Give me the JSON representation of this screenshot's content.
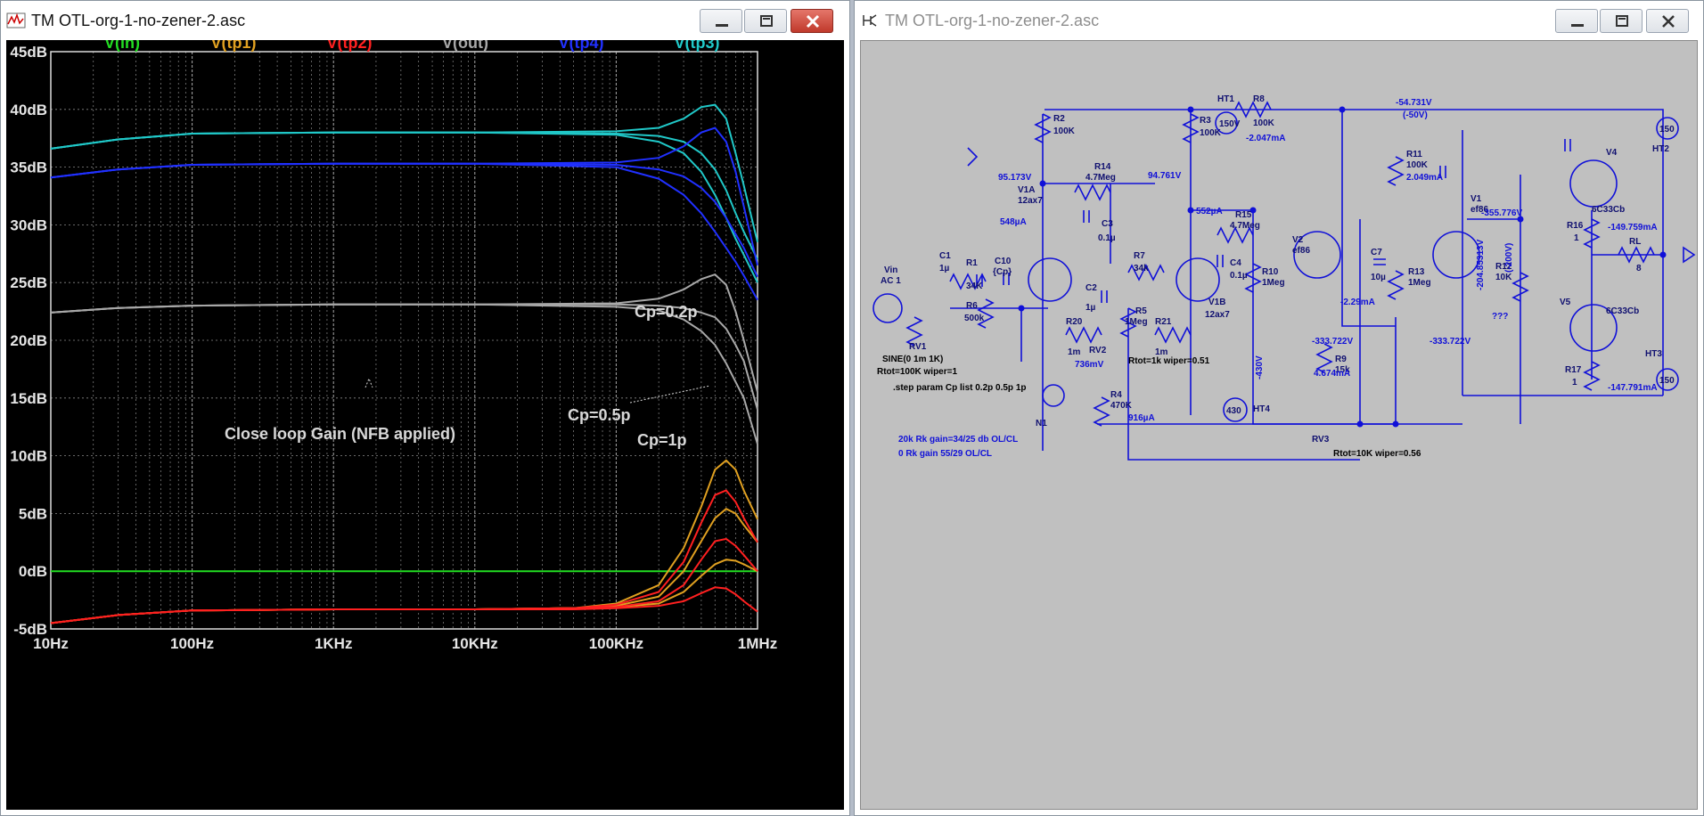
{
  "left_window": {
    "title": "TM OTL-org-1-no-zener-2.asc"
  },
  "right_window": {
    "title": "TM OTL-org-1-no-zener-2.asc"
  },
  "plot": {
    "traces": [
      {
        "name": "V(in)",
        "color": "#22dd22"
      },
      {
        "name": "V(tp1)",
        "color": "#e0a020"
      },
      {
        "name": "V(tp2)",
        "color": "#ff2020"
      },
      {
        "name": "V(out)",
        "color": "#a8a8a8"
      },
      {
        "name": "V(tp4)",
        "color": "#2030ff"
      },
      {
        "name": "V(tp3)",
        "color": "#20c8c8"
      }
    ],
    "annotations": {
      "cp02": "Cp=0.2p",
      "cp05": "Cp=0.5p",
      "cp1": "Cp=1p",
      "close_loop": "Close loop Gain (NFB applied)"
    }
  },
  "chart_data": {
    "type": "line",
    "xscale": "log",
    "xlim": [
      10,
      1000000
    ],
    "ylim": [
      -5,
      45
    ],
    "x_tick_labels": [
      "10Hz",
      "100Hz",
      "1KHz",
      "10KHz",
      "100KHz",
      "1MHz"
    ],
    "y_tick_labels": [
      "45dB",
      "40dB",
      "35dB",
      "30dB",
      "25dB",
      "20dB",
      "15dB",
      "10dB",
      "5dB",
      "0dB",
      "-5dB"
    ],
    "grid": true,
    "legend": "top",
    "series": [
      {
        "name": "V(in)",
        "color": "#22dd22",
        "curves": [
          {
            "x": [
              10,
              1000000
            ],
            "y": [
              0,
              0
            ]
          }
        ]
      },
      {
        "name": "V(tp3)",
        "color": "#20c8c8",
        "curves": [
          {
            "x": [
              10,
              30,
              100,
              1000,
              10000,
              100000,
              200000,
              300000,
              400000,
              500000,
              600000,
              700000,
              800000,
              1000000
            ],
            "y": [
              36.6,
              37.4,
              37.9,
              38,
              38,
              38.1,
              38.4,
              39.2,
              40.2,
              40.4,
              39.2,
              36.2,
              33.4,
              28.5
            ]
          },
          {
            "x": [
              10,
              30,
              100,
              1000,
              10000,
              100000,
              200000,
              300000,
              400000,
              500000,
              600000,
              700000,
              800000,
              1000000
            ],
            "y": [
              36.6,
              37.4,
              37.9,
              38,
              38,
              37.9,
              37.7,
              37.2,
              36.2,
              34.8,
              33,
              31,
              29.4,
              27
            ]
          },
          {
            "x": [
              10,
              30,
              100,
              1000,
              10000,
              100000,
              200000,
              300000,
              400000,
              500000,
              600000,
              700000,
              800000,
              1000000
            ],
            "y": [
              36.6,
              37.4,
              37.9,
              38,
              38,
              37.8,
              37.2,
              36.2,
              34.6,
              32.6,
              30.6,
              28.8,
              27.4,
              25
            ]
          }
        ]
      },
      {
        "name": "V(tp4)",
        "color": "#2030ff",
        "curves": [
          {
            "x": [
              10,
              30,
              100,
              1000,
              10000,
              100000,
              200000,
              300000,
              400000,
              500000,
              600000,
              700000,
              800000,
              1000000
            ],
            "y": [
              34.1,
              34.8,
              35.2,
              35.3,
              35.3,
              35.4,
              35.8,
              36.8,
              38,
              38.4,
              37.2,
              34.6,
              31.6,
              26.5
            ]
          },
          {
            "x": [
              10,
              30,
              100,
              1000,
              10000,
              100000,
              200000,
              300000,
              400000,
              500000,
              600000,
              700000,
              800000,
              1000000
            ],
            "y": [
              34.1,
              34.8,
              35.2,
              35.3,
              35.3,
              35.2,
              34.8,
              34.2,
              33.2,
              32,
              30.6,
              29.2,
              28,
              25.5
            ]
          },
          {
            "x": [
              10,
              30,
              100,
              1000,
              10000,
              100000,
              200000,
              300000,
              400000,
              500000,
              600000,
              700000,
              800000,
              1000000
            ],
            "y": [
              34.1,
              34.8,
              35.2,
              35.3,
              35.3,
              35,
              34,
              32.6,
              31,
              29.4,
              28,
              26.8,
              25.6,
              23.5
            ]
          }
        ]
      },
      {
        "name": "V(out)",
        "color": "#a8a8a8",
        "curves": [
          {
            "x": [
              10,
              30,
              100,
              1000,
              10000,
              100000,
              200000,
              300000,
              400000,
              500000,
              600000,
              700000,
              800000,
              1000000
            ],
            "y": [
              22.4,
              22.8,
              23,
              23.1,
              23.1,
              23.2,
              23.6,
              24.4,
              25.3,
              25.7,
              24.8,
              22.5,
              20,
              15.5
            ]
          },
          {
            "x": [
              10,
              30,
              100,
              1000,
              10000,
              100000,
              200000,
              300000,
              400000,
              500000,
              600000,
              700000,
              800000,
              1000000
            ],
            "y": [
              22.4,
              22.8,
              23,
              23.1,
              23.1,
              23.1,
              23,
              22.8,
              22.4,
              22,
              21,
              19.6,
              18.2,
              14
            ]
          },
          {
            "x": [
              10,
              30,
              100,
              1000,
              10000,
              100000,
              200000,
              300000,
              400000,
              500000,
              600000,
              700000,
              800000,
              1000000
            ],
            "y": [
              22.4,
              22.8,
              23,
              23.1,
              23.1,
              22.9,
              22.6,
              21.8,
              20.8,
              19.6,
              18,
              16.4,
              15,
              11
            ]
          }
        ]
      },
      {
        "name": "V(tp1)",
        "color": "#e0a020",
        "curves": [
          {
            "x": [
              10,
              30,
              100,
              1000,
              10000,
              50000,
              100000,
              200000,
              300000,
              400000,
              500000,
              600000,
              700000,
              800000,
              1000000
            ],
            "y": [
              -4.5,
              -3.8,
              -3.4,
              -3.3,
              -3.3,
              -3.2,
              -2.8,
              -1.2,
              2,
              5.6,
              8.8,
              9.6,
              8.8,
              7,
              4.5
            ]
          },
          {
            "x": [
              10,
              30,
              100,
              1000,
              10000,
              50000,
              100000,
              200000,
              300000,
              400000,
              500000,
              600000,
              700000,
              800000,
              1000000
            ],
            "y": [
              -4.5,
              -3.8,
              -3.4,
              -3.3,
              -3.3,
              -3.2,
              -3,
              -2.2,
              0,
              2.6,
              4.6,
              5.4,
              5,
              4,
              2.5
            ]
          },
          {
            "x": [
              10,
              30,
              100,
              1000,
              10000,
              50000,
              100000,
              200000,
              300000,
              400000,
              500000,
              600000,
              700000,
              800000,
              1000000
            ],
            "y": [
              -4.5,
              -3.8,
              -3.4,
              -3.3,
              -3.3,
              -3.2,
              -3.1,
              -2.8,
              -1.8,
              -0.4,
              0.6,
              1,
              0.9,
              0.6,
              0
            ]
          }
        ]
      },
      {
        "name": "V(tp2)",
        "color": "#ff2020",
        "curves": [
          {
            "x": [
              10,
              30,
              100,
              1000,
              10000,
              50000,
              100000,
              200000,
              300000,
              400000,
              500000,
              600000,
              700000,
              800000,
              1000000
            ],
            "y": [
              -4.5,
              -3.8,
              -3.4,
              -3.3,
              -3.3,
              -3.2,
              -2.9,
              -1.8,
              0.8,
              4.2,
              6.6,
              7,
              6,
              4.6,
              2.5
            ]
          },
          {
            "x": [
              10,
              30,
              100,
              1000,
              10000,
              50000,
              100000,
              200000,
              300000,
              400000,
              500000,
              600000,
              700000,
              800000,
              1000000
            ],
            "y": [
              -4.5,
              -3.8,
              -3.4,
              -3.3,
              -3.3,
              -3.2,
              -3.1,
              -2.6,
              -1.2,
              1,
              2.6,
              2.8,
              2.2,
              1.4,
              0
            ]
          },
          {
            "x": [
              10,
              30,
              100,
              1000,
              10000,
              50000,
              100000,
              200000,
              300000,
              400000,
              500000,
              600000,
              700000,
              800000,
              1000000
            ],
            "y": [
              -4.5,
              -3.8,
              -3.4,
              -3.3,
              -3.3,
              -3.3,
              -3.2,
              -3,
              -2.6,
              -1.9,
              -1.4,
              -1.5,
              -2,
              -2.6,
              -3.5
            ]
          }
        ]
      }
    ]
  },
  "schematic": {
    "components": [
      "HT1",
      "R8",
      "100K",
      "R2",
      "100K",
      "R3",
      "100K",
      "R14",
      "4.7Meg",
      "C3",
      "0.1µ",
      "V1A",
      "12ax7",
      "R15",
      "4.7Meg",
      "C4",
      "0.1µ",
      "V2",
      "ef86",
      "C7",
      "10µ",
      "R13",
      "1Meg",
      "V1",
      "ef86",
      "R11",
      "100K",
      "R12",
      "10K",
      "V4",
      "6C33Cb",
      "HT2",
      "150",
      "R16",
      "1",
      "RL",
      "8",
      "V5",
      "6C33Cb",
      "R17",
      "1",
      "HT3",
      "150",
      "C1",
      "1µ",
      "R1",
      "34K",
      "R6",
      "500k",
      "C10",
      "{Cp}",
      "C2",
      "1µ",
      "R7",
      "34k",
      "R5",
      "1Meg",
      "V1B",
      "12ax7",
      "R10",
      "1Meg",
      "R20",
      "1m",
      "RV2",
      "R21",
      "1m",
      "R4",
      "470K",
      "HT4",
      "430",
      "R9",
      "15k",
      "RV3",
      "RV1",
      "Vin",
      "AC 1",
      "N1",
      "150V"
    ],
    "voltages": {
      "v_54731": "-54.731V",
      "v_50": "(-50V)",
      "i_2047": "-2.047mA",
      "v_95173": "95.173V",
      "v_94761": "94.761V",
      "i_548": "548µA",
      "i_552": "552µA",
      "i_2049": "2.049mA",
      "v_355776": "-355.776V",
      "v_204853": "-204.85313V",
      "v_200": "(-200V)",
      "i_149759": "-149.759mA",
      "i_229": "-2.29mA",
      "v_333722a": "-333.722V",
      "v_333722b": "-333.722V",
      "v_430": "-430V",
      "i_4674": "4.674mA",
      "i_147791": "-147.791mA",
      "v_736": "736mV",
      "i_916": "916µA",
      "qqq": "???"
    },
    "directives": {
      "sine": "SINE(0 1m 1K)",
      "rtot1": "Rtot=100K wiper=1",
      "step": ".step param Cp list 0.2p 0.5p 1p",
      "rtot2": "Rtot=1k wiper=0.51",
      "rtot3": "Rtot=10K wiper=0.56",
      "note1": "20k Rk gain=34/25 db OL/CL",
      "note2": "0 Rk gain 55/29 OL/CL"
    }
  }
}
